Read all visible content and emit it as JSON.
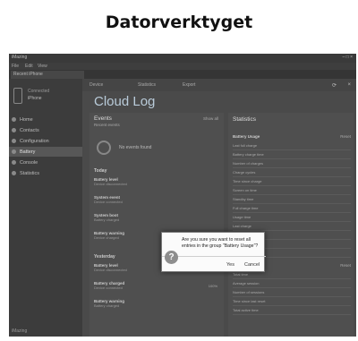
{
  "heading": "Datorverktyget",
  "window": {
    "title": "iMazing",
    "menu": [
      "File",
      "Edit",
      "View"
    ],
    "tab_label": "Recent iPhone",
    "controls": "– □ ×"
  },
  "device": {
    "line1": "Connected",
    "line2": "iPhone"
  },
  "sidebar": {
    "items": [
      {
        "label": "Home",
        "active": false
      },
      {
        "label": "Contacts",
        "active": false
      },
      {
        "label": "Configuration",
        "active": false
      },
      {
        "label": "Battery",
        "active": true
      },
      {
        "label": "Console",
        "active": false
      },
      {
        "label": "Statistics",
        "active": false
      }
    ],
    "footer": "iMazing"
  },
  "toolbar": {
    "items": [
      "Device",
      "Statistics",
      "Export"
    ]
  },
  "page_title": "Cloud Log",
  "events": {
    "title": "Events",
    "subtitle": "Recent events",
    "filter": "Show all",
    "empty_text": "No events found",
    "sections": [
      {
        "label": "Today",
        "items": [
          {
            "title": "Battery level",
            "sub": "Device disconnected",
            "value": ""
          },
          {
            "title": "System event",
            "sub": "Device connected",
            "value": ""
          },
          {
            "title": "System boot",
            "sub": "Battery charged",
            "value": ""
          },
          {
            "title": "Battery warning",
            "sub": "Device charged",
            "value": "Warning"
          }
        ]
      },
      {
        "label": "Yesterday",
        "items": [
          {
            "title": "Battery level",
            "sub": "Device disconnected",
            "value": ""
          },
          {
            "title": "Battery charged",
            "sub": "Device connected",
            "value": "100%"
          },
          {
            "title": "Battery warning",
            "sub": "Battery charged",
            "value": ""
          }
        ]
      }
    ]
  },
  "statistics": {
    "title": "Statistics",
    "groups": [
      {
        "label": "Battery Usage",
        "action": "Reset",
        "rows": [
          {
            "k": "Last full charge",
            "v": ""
          },
          {
            "k": "Battery charge time",
            "v": ""
          },
          {
            "k": "Number of charges",
            "v": ""
          },
          {
            "k": "Charge cycles",
            "v": ""
          },
          {
            "k": "Time since charge",
            "v": ""
          },
          {
            "k": "Screen on time",
            "v": ""
          },
          {
            "k": "Standby time",
            "v": ""
          },
          {
            "k": "Full charge time",
            "v": ""
          },
          {
            "k": "Usage time",
            "v": ""
          },
          {
            "k": "Last charge",
            "v": ""
          },
          {
            "k": "Average usage",
            "v": ""
          },
          {
            "k": "Number of unlocks",
            "v": ""
          },
          {
            "k": "Number of warnings",
            "v": ""
          }
        ]
      },
      {
        "label": "Device Usage",
        "action": "Reset",
        "rows": [
          {
            "k": "Total time",
            "v": ""
          },
          {
            "k": "Average session",
            "v": ""
          },
          {
            "k": "Number of sessions",
            "v": ""
          },
          {
            "k": "Time since last reset",
            "v": ""
          },
          {
            "k": "Total active time",
            "v": ""
          }
        ]
      }
    ]
  },
  "dialog": {
    "message": "Are you sure you want to reset all entries in the group \"Battery Usage\"?",
    "icon": "question-icon",
    "yes": "Yes",
    "cancel": "Cancel"
  }
}
